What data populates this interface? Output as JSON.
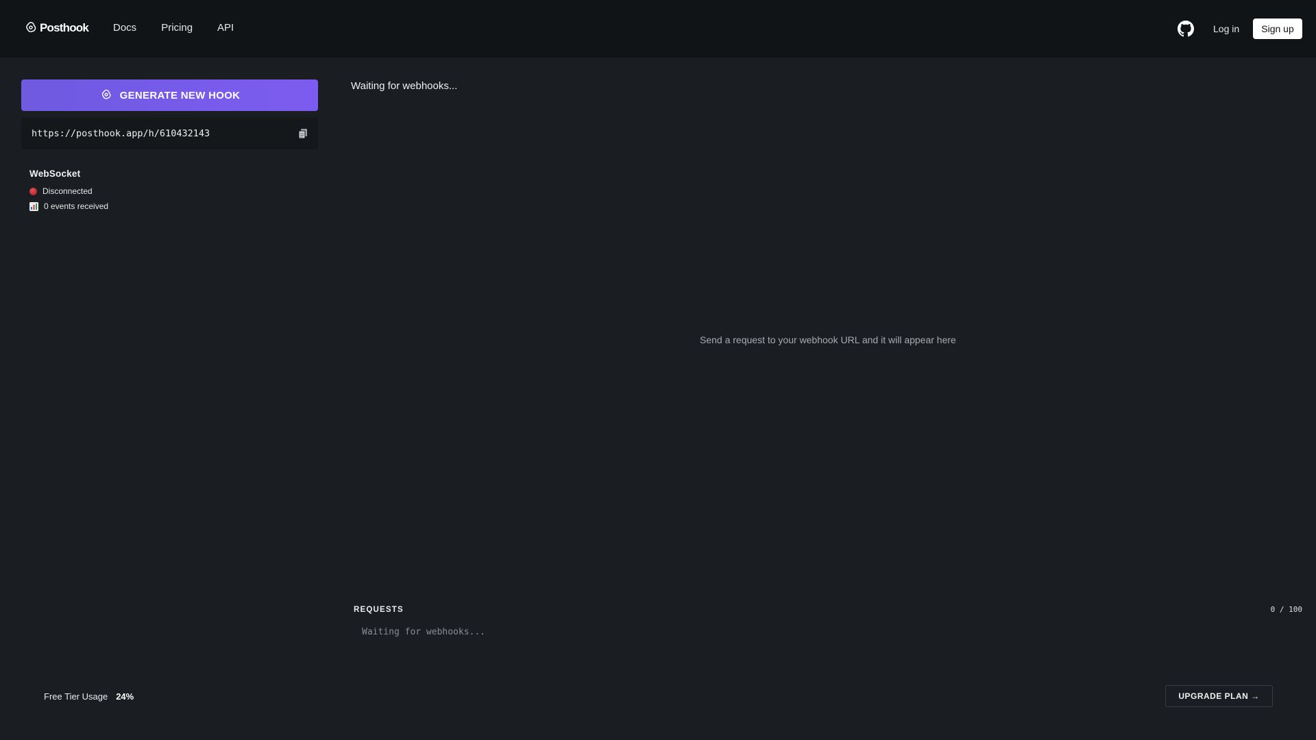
{
  "header": {
    "brand": "Posthook",
    "nav": [
      "Docs",
      "Pricing",
      "API"
    ],
    "login_label": "Log in",
    "signup_label": "Sign up"
  },
  "sidebar": {
    "generate_label": "GENERATE NEW HOOK",
    "hook_url": "https://posthook.app/h/610432143",
    "websocket": {
      "title": "WebSocket",
      "status": "Disconnected",
      "events": "0 events received"
    }
  },
  "main": {
    "title": "Waiting for webhooks...",
    "empty_message": "Send a request to your webhook URL and it will appear here",
    "requests_label": "REQUESTS",
    "requests_count": "0 / 100",
    "requests_waiting": "Waiting for webhooks..."
  },
  "footer": {
    "usage_label": "Free Tier Usage",
    "usage_value": "24%",
    "upgrade_label": "UPGRADE PLAN →"
  },
  "colors": {
    "accent": "#7c5cf0",
    "background": "#1a1d21",
    "header_bg": "#111417",
    "status_disconnected": "#c0343a"
  },
  "icons": [
    "logo-icon",
    "github-icon",
    "hook-icon",
    "copy-icon",
    "status-dot-icon",
    "bar-chart-icon"
  ]
}
